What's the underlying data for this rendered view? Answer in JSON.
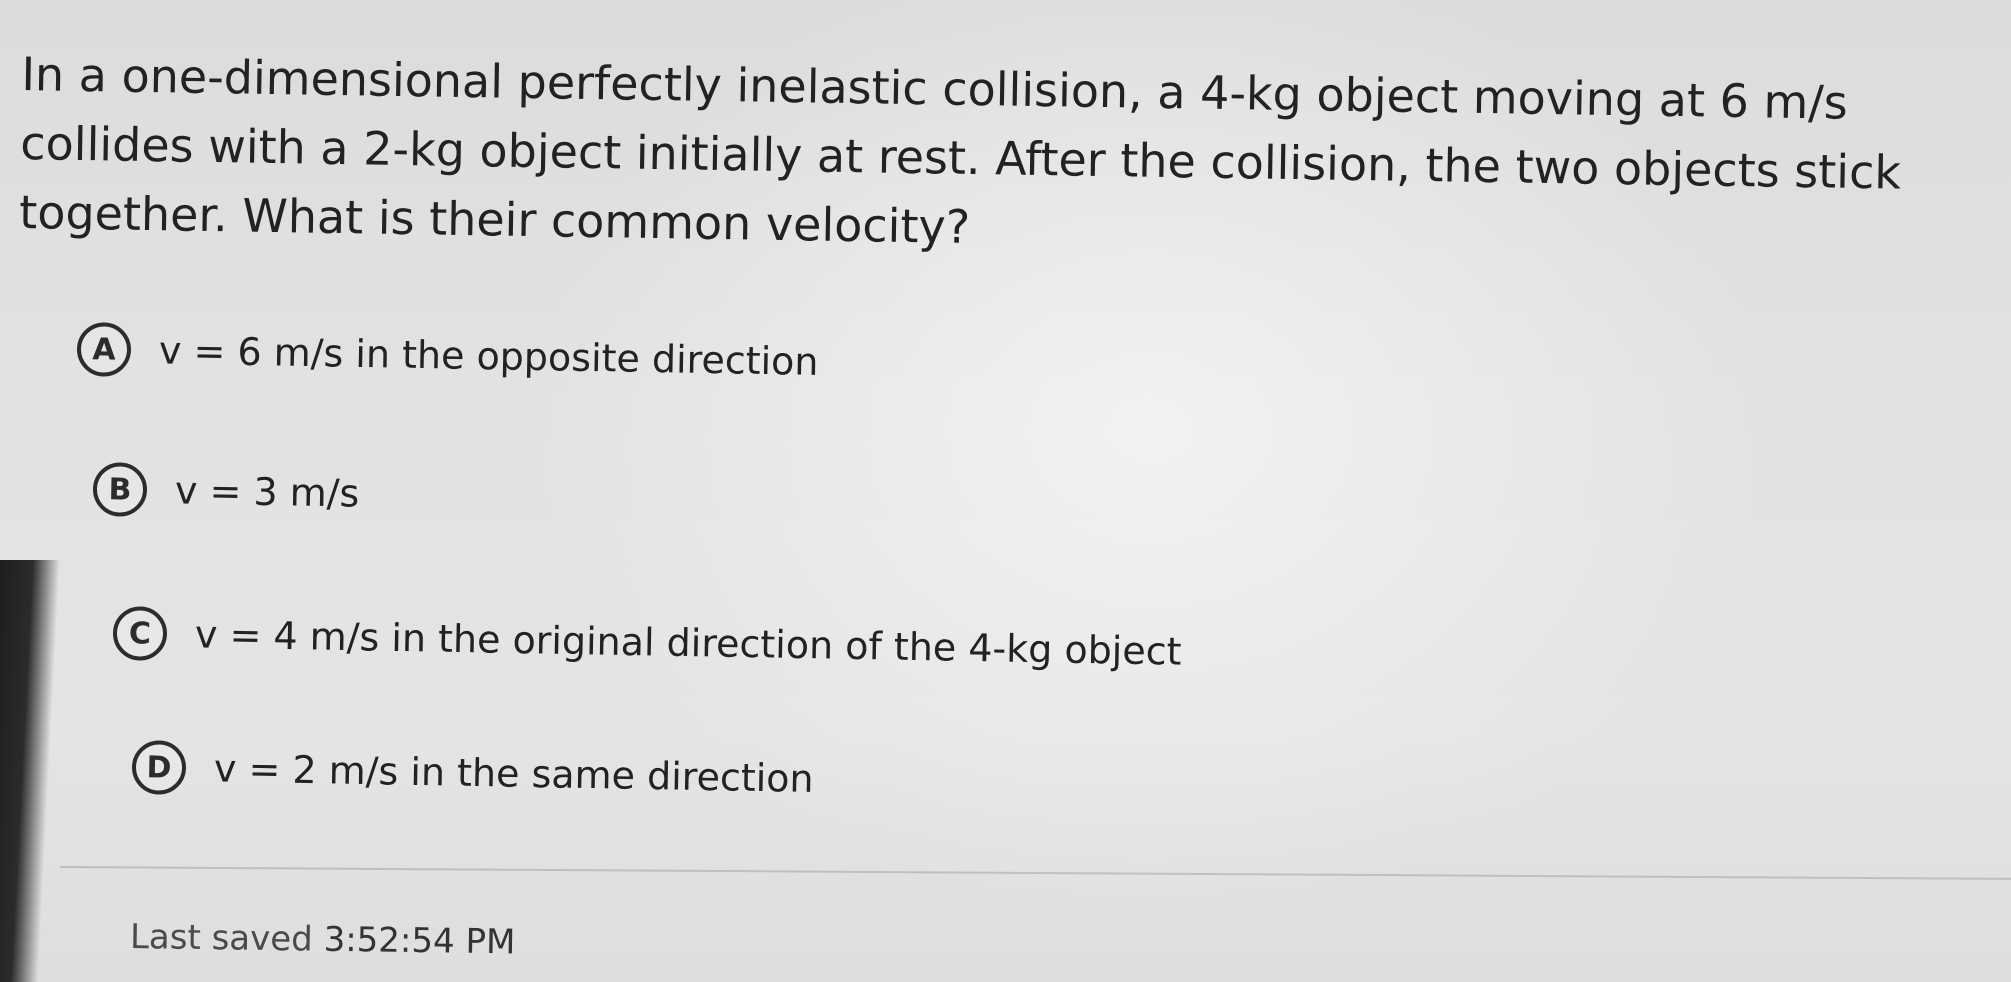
{
  "question": {
    "text": "In a one-dimensional perfectly inelastic collision, a 4-kg object moving at 6 m/s collides with a 2-kg object initially at rest. After the collision, the two objects stick together. What is their common velocity?"
  },
  "options": [
    {
      "letter": "A",
      "text": "v = 6 m/s in the opposite direction"
    },
    {
      "letter": "B",
      "text": "v = 3 m/s"
    },
    {
      "letter": "C",
      "text": "v = 4 m/s in the original direction of the 4-kg object"
    },
    {
      "letter": "D",
      "text": "v = 2 m/s in the same direction"
    }
  ],
  "status": {
    "label": "Last saved",
    "time": "3:52:54 PM"
  }
}
